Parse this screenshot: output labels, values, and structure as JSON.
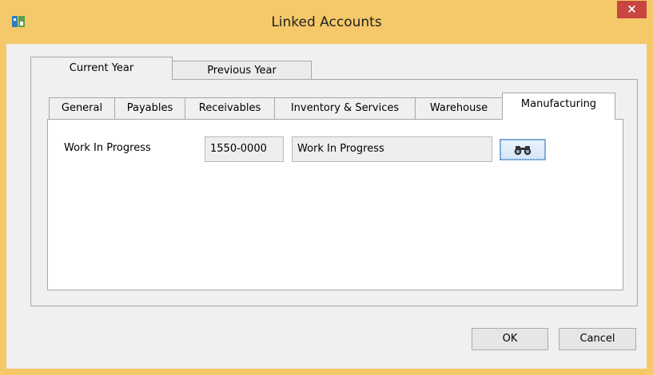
{
  "window": {
    "title": "Linked Accounts",
    "close_glyph": "×"
  },
  "outer_tabs": [
    {
      "label": "Current Year"
    },
    {
      "label": "Previous Year"
    }
  ],
  "inner_tabs": [
    {
      "label": "General"
    },
    {
      "label": "Payables"
    },
    {
      "label": "Receivables"
    },
    {
      "label": "Inventory & Services"
    },
    {
      "label": "Warehouse"
    },
    {
      "label": "Manufacturing"
    }
  ],
  "manufacturing": {
    "field_label": "Work In Progress",
    "account_number": "1550-0000",
    "account_name": "Work In Progress",
    "lookup_icon": "binoculars-icon"
  },
  "buttons": {
    "ok": "OK",
    "cancel": "Cancel"
  },
  "colors": {
    "titlebar": "#f5c869",
    "close": "#c7463f",
    "focus": "#2a6fc0"
  }
}
